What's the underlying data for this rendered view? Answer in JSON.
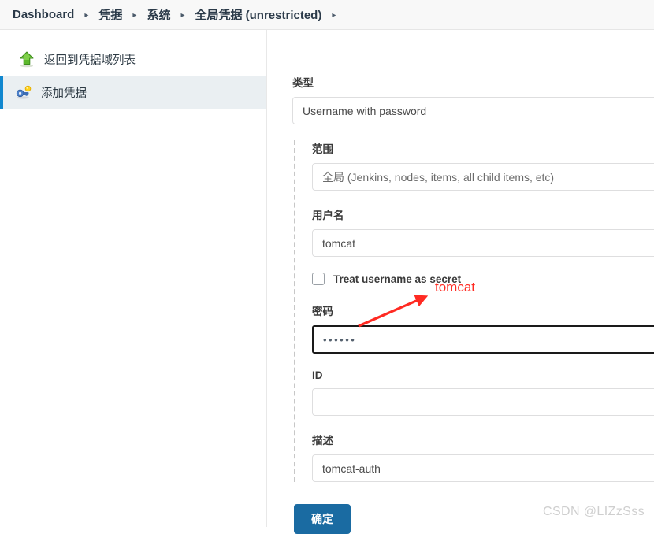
{
  "breadcrumb": {
    "items": [
      {
        "label": "Dashboard"
      },
      {
        "label": "凭据"
      },
      {
        "label": "系统"
      },
      {
        "label": "全局凭据 (unrestricted)"
      }
    ],
    "separator": "▸"
  },
  "sidebar": {
    "items": [
      {
        "label": "返回到凭据域列表",
        "icon": "green-up-arrow-icon",
        "selected": false
      },
      {
        "label": "添加凭据",
        "icon": "key-icon",
        "selected": true
      }
    ]
  },
  "form": {
    "kind": {
      "label": "类型",
      "value": "Username with password"
    },
    "scope": {
      "label": "范围",
      "value": "全局 (Jenkins, nodes, items, all child items, etc)"
    },
    "username": {
      "label": "用户名",
      "value": "tomcat",
      "placeholder": ""
    },
    "username_secret": {
      "label": "Treat username as secret",
      "checked": false
    },
    "password": {
      "label": "密码",
      "value": "••••••",
      "masked_length": 6
    },
    "id": {
      "label": "ID",
      "value": "",
      "placeholder": ""
    },
    "description": {
      "label": "描述",
      "value": "tomcat-auth",
      "placeholder": ""
    },
    "submit_label": "确定"
  },
  "annotation": {
    "text": "tomcat",
    "color": "#ff2a22"
  },
  "watermark": {
    "text": "CSDN @LIZzSss"
  },
  "colors": {
    "accent_blue": "#1a6ba2",
    "selected_border": "#1187cf",
    "selected_bg": "#eaeff2",
    "annotation_red": "#ff2a22",
    "header_bg": "#f8f8f8"
  }
}
